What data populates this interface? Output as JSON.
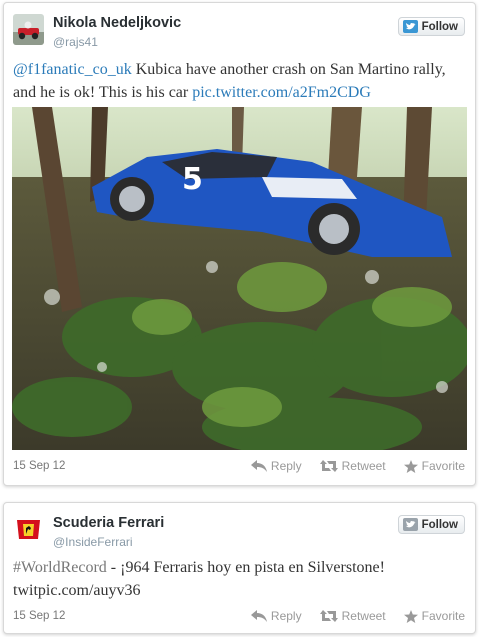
{
  "tweets": [
    {
      "author_name": "Nikola Nedeljkovic",
      "handle": "@rajs41",
      "follow_label": "Follow",
      "mention": "@f1fanatic_co_uk",
      "text_main": " Kubica have another crash on San Martino rally, and he is ok! This is his car ",
      "link_text": "pic.twitter.com/a2Fm2CDG",
      "date": "15 Sep 12",
      "actions": {
        "reply": "Reply",
        "retweet": "Retweet",
        "favorite": "Favorite"
      },
      "photo_car_number": "5"
    },
    {
      "author_name": "Scuderia Ferrari",
      "handle": "@InsideFerrari",
      "follow_label": "Follow",
      "hashtag": "#WorldRecord",
      "text_main": " - ¡964 Ferraris hoy en pista en Silverstone!",
      "link_text": "twitpic.com/auyv36",
      "date": "15 Sep 12",
      "actions": {
        "reply": "Reply",
        "retweet": "Retweet",
        "favorite": "Favorite"
      }
    }
  ],
  "icons": {
    "avatar1": "kart-avatar-icon",
    "avatar2": "ferrari-logo-icon",
    "follow": "twitter-bird-icon",
    "reply": "reply-arrow-icon",
    "retweet": "retweet-icon",
    "favorite": "star-icon"
  },
  "colors": {
    "link": "#2b7bb9",
    "muted": "#999999",
    "follow_bird": "#3a97d4"
  }
}
